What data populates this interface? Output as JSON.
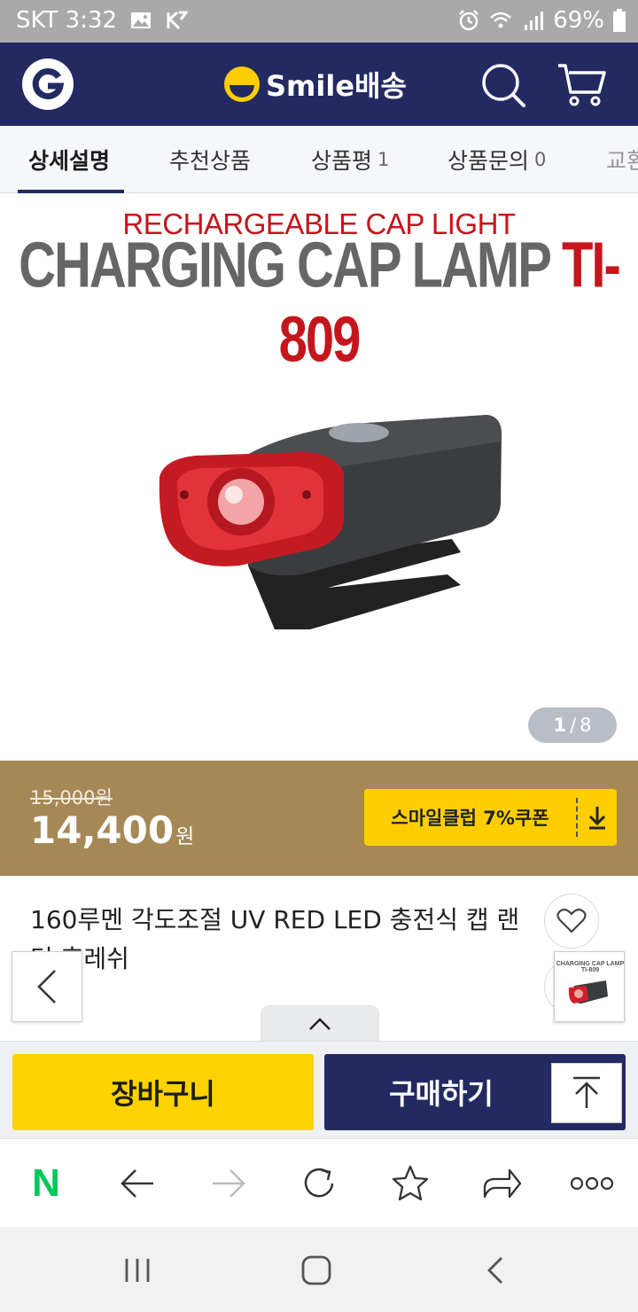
{
  "status_bar": {
    "carrier_time": "SKT 3:32",
    "battery": "69%"
  },
  "header": {
    "brand_text": "Smile배송"
  },
  "tabs": [
    {
      "label": "상세설명",
      "count": ""
    },
    {
      "label": "추천상품",
      "count": ""
    },
    {
      "label": "상품평",
      "count": "1"
    },
    {
      "label": "상품문의",
      "count": "0"
    },
    {
      "label": "교환",
      "count": ""
    }
  ],
  "image": {
    "subtitle": "RECHARGEABLE CAP LIGHT",
    "title": "CHARGING CAP LAMP",
    "model": "TI-809",
    "page_current": "1",
    "page_sep": "/",
    "page_total": "8",
    "thumb_text": "CHARGING CAP LAMP TI-809",
    "colors": {
      "accent_red": "#c4161c",
      "title_gray": "#666666"
    }
  },
  "price": {
    "original": "15,000원",
    "sale": "14,400",
    "unit": "원",
    "coupon_label": "스마일클럽 7%쿠폰"
  },
  "product": {
    "title": "160루멘 각도조절 UV RED LED 충전식 캡 랜턴 후레쉬"
  },
  "actions": {
    "cart_label": "장바구니",
    "buy_label": "구매하기"
  },
  "browser": {
    "naver_logo": "N"
  },
  "colors": {
    "navy": "#232a62",
    "yellow": "#ffd200",
    "price_bar": "#a68856",
    "naver_green": "#03c75a"
  }
}
